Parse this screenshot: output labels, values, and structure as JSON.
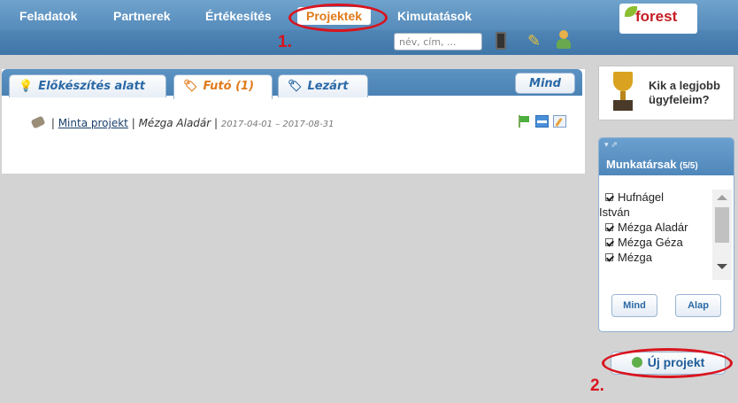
{
  "nav": {
    "items": [
      "Feladatok",
      "Partnerek",
      "Értékesítés",
      "Projektek",
      "Kimutatások"
    ],
    "search_placeholder": "név, cím, ...",
    "logo_text": "forest"
  },
  "annotations": {
    "one": "1.",
    "two": "2."
  },
  "tabs": {
    "prep": "Előkészítés alatt",
    "running": "Futó (1)",
    "closed": "Lezárt",
    "all": "Mind"
  },
  "project_row": {
    "sep1": "|",
    "name": "Minta projekt",
    "sep2": "|",
    "owner": "Mézga Aladár",
    "sep3": "|",
    "dates": "2017-04-01 – 2017-08-31"
  },
  "trophy": {
    "line1": "Kik a legjobb",
    "line2": "ügyfeleim?"
  },
  "colleagues": {
    "title": "Munkatársak",
    "count": "(5/5)",
    "items": [
      "Hufnágel",
      "István",
      "Mézga Aladár",
      "Mézga Géza",
      "Mézga"
    ],
    "all_button": "Mind",
    "default_button": "Alap"
  },
  "new_project_button": "Új projekt",
  "colors": {
    "accent": "#e07a1a",
    "nav": "#5a8fbe",
    "annotation": "#d9141e"
  }
}
